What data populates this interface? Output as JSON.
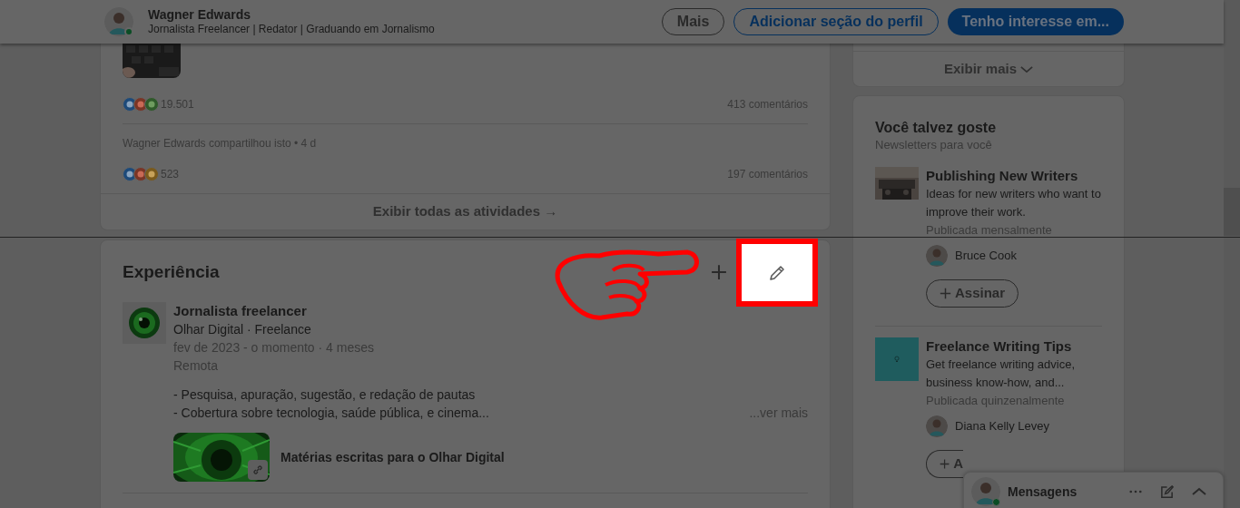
{
  "profile_bar": {
    "name": "Wagner Edwards",
    "headline": "Jornalista Freelancer | Redator | Graduando em Jornalismo",
    "online": true,
    "buttons": [
      {
        "label": "Mais",
        "kind": "outline"
      },
      {
        "label": "Adicionar seção do perfil",
        "kind": "outline-primary"
      },
      {
        "label": "Tenho interesse em...",
        "kind": "primary"
      }
    ]
  },
  "activity": {
    "posts": [
      {
        "reactions": [
          {
            "kind": "like"
          },
          {
            "kind": "love"
          },
          {
            "kind": "support"
          }
        ],
        "reaction_count": "19.501",
        "comments": "413 comentários"
      },
      {
        "shared_by": "Wagner Edwards compartilhou isto • 4 d",
        "reactions": [
          {
            "kind": "like"
          },
          {
            "kind": "love"
          },
          {
            "kind": "insight"
          }
        ],
        "reaction_count": "523",
        "comments": "197 comentários"
      }
    ],
    "show_all": "Exibir todas as atividades →"
  },
  "experience": {
    "title": "Experiência",
    "entries": [
      {
        "role": "Jornalista freelancer",
        "company": "Olhar Digital · Freelance",
        "dates": "fev de 2023 - o momento · 4 meses",
        "location": "Remota",
        "description": [
          "- Pesquisa, apuração, sugestão, e redação de pautas",
          "- Cobertura sobre tecnologia, saúde pública, e cinema..."
        ],
        "more": "...ver mais",
        "media_title": "Matérias escritas para o Olhar Digital"
      }
    ]
  },
  "sidebar": {
    "show_more": "Exibir mais",
    "suggestions": {
      "title": "Você talvez goste",
      "subtitle": "Newsletters para você",
      "newsletters": [
        {
          "title": "Publishing New Writers",
          "description": "Ideas for new writers who want to improve their work.",
          "frequency": "Publicada mensalmente",
          "author": "Bruce Cook",
          "button": "Assinar"
        },
        {
          "kind": "logo",
          "title": "Freelance Writing Tips",
          "description": "Get freelance writing advice, business know-how, and...",
          "frequency": "Publicada quinzenalmente",
          "author": "Diana Kelly Levey",
          "button": "A"
        }
      ]
    }
  },
  "messaging": {
    "title": "Mensagens",
    "online": true
  }
}
